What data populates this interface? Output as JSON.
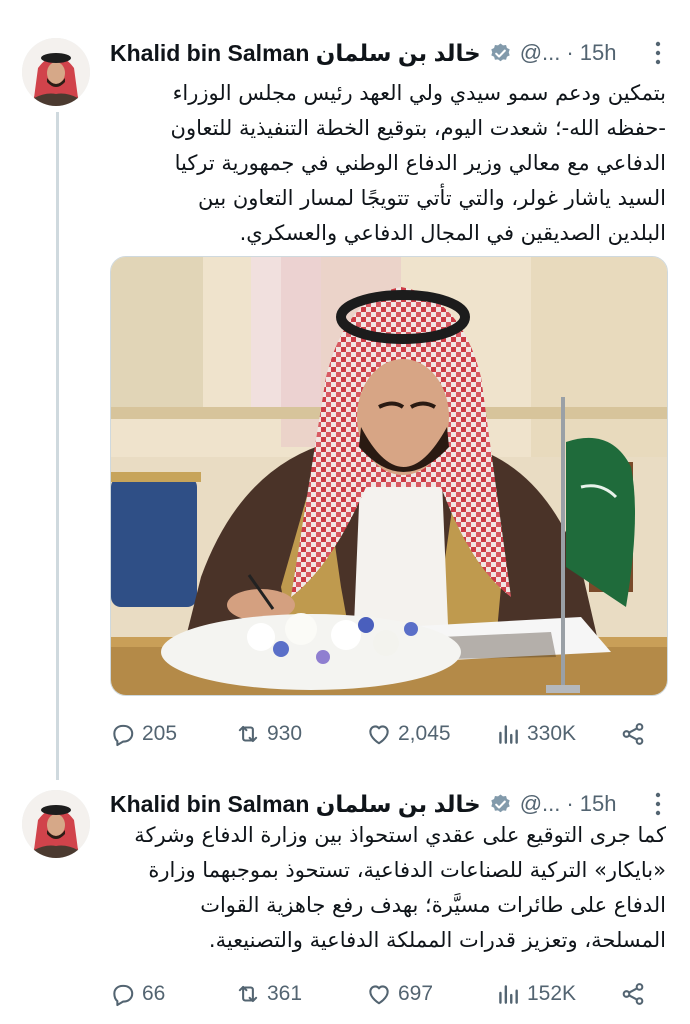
{
  "tweets": [
    {
      "display_name": "Khalid bin Salman خالد بن سلمان",
      "handle": "@...",
      "time": "15h",
      "text_lines": [
        "بتمكين ودعم سمو سيدي ولي العهد رئيس مجلس الوزراء",
        "-حفظه الله-؛ شعدت اليوم، بتوقيع الخطة التنفيذية للتعاون",
        "الدفاعي مع معالي وزير الدفاع الوطني في جمهورية تركيا",
        "السيد ياشار غولر، والتي تأتي تتويجًا لمسار التعاون بين",
        "البلدين الصديقين في المجال الدفاعي والعسكري."
      ],
      "has_image": true,
      "stats": {
        "replies": "205",
        "retweets": "930",
        "likes": "2,045",
        "views": "330K"
      }
    },
    {
      "display_name": "Khalid bin Salman خالد بن سلمان",
      "handle": "@...",
      "time": "15h",
      "text_lines": [
        "كما جرى التوقيع على عقدي استحواذ بين وزارة الدفاع وشركة",
        "«بايكار» التركية للصناعات الدفاعية، تستحوذ بموجبهما وزارة",
        "الدفاع على طائرات مسيَّرة؛ بهدف رفع جاهزية القوات",
        "المسلحة، وتعزيز قدرات المملكة الدفاعية والتصنيعية."
      ],
      "has_image": false,
      "stats": {
        "replies": "66",
        "retweets": "361",
        "likes": "697",
        "views": "152K"
      }
    }
  ],
  "icons": {
    "reply": "reply-icon",
    "retweet": "retweet-icon",
    "like": "heart-icon",
    "views": "views-icon",
    "share": "share-icon",
    "verified": "verified-badge-icon",
    "more": "more-icon"
  },
  "colors": {
    "text": "#0f1419",
    "muted": "#536471",
    "verified_badge": "#829aab",
    "thread_line": "#cfd9de"
  }
}
